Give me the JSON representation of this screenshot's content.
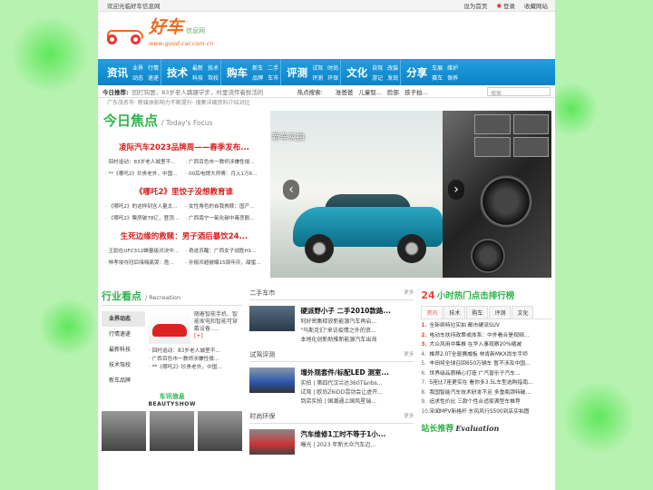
{
  "topbar": {
    "welcome": "欢迎光临好车信息网",
    "home": "设为首页",
    "login": "登录",
    "fav": "收藏网站"
  },
  "logo": {
    "brand": "好车",
    "tag": "信息网",
    "url": "www.good-car.com.cn"
  },
  "nav": [
    {
      "big": "资讯",
      "subs": [
        "业界",
        "行情",
        "动态",
        "速递"
      ]
    },
    {
      "big": "技术",
      "subs": [
        "最新",
        "技术",
        "科技",
        "驾校"
      ]
    },
    {
      "big": "购车",
      "subs": [
        "新车",
        "二手",
        "品牌",
        "车市"
      ]
    },
    {
      "big": "评测",
      "subs": [
        "试驾",
        "时尚",
        "评测",
        "环保"
      ]
    },
    {
      "big": "文化",
      "subs": [
        "自驾",
        "改装",
        "游记",
        "发现"
      ]
    },
    {
      "big": "分享",
      "subs": [
        "车展",
        "维护",
        "赛车",
        "保养"
      ]
    }
  ],
  "subnav": {
    "label": "今日推荐:",
    "ticker": "回打钩罢，83岁老人蹒跚学步，村里流传着鲜活的",
    "hot_label": "热点搜索:",
    "hot": [
      "准爸爸",
      "儿童智...",
      "脸部",
      "孩子拍..."
    ],
    "search_placeholder": "搜索"
  },
  "ticker2": "广东茂名市·  新媒体影响力不断提升·  搜集详细资料介绍对比",
  "focus": {
    "title": "今日焦点",
    "en": "/ Today's Focus",
    "blocks": [
      {
        "headline": "凌际汽车2023品牌周——春季发布...",
        "items": [
          "回村追动：83岁老人城里不...",
          "广西百色市一教师涉嫌性侵...",
          "**《哪吒2》珍贵老外，中国...",
          "00后电焊大师傅：月入1万6..."
        ]
      },
      {
        "headline": "《哪吒2》里饺子没想教育谁",
        "items": [
          "《哪吒2》的这样刻含人量太...",
          "女性角色的自我救赎：国产...",
          "《哪吒2》票房破78亿，登顶...",
          "广西南宁一氧化碳中毒悲剧..."
        ]
      },
      {
        "headline": "生死边缘的救赎：男子酒后暴饮24...",
        "items": [
          "王励在UFC312蝉量级对决中...",
          "奇迹苏醒：广西女子战胜H1...",
          "林孝埈夺冠后嗨嗨痛哭：胜...",
          "孙俪邓超被曝15周年庆，甜蜜..."
        ]
      }
    ]
  },
  "slider": {
    "caption": "新车实拍"
  },
  "leisure": {
    "title": "行业看点",
    "en": "/ Recreation",
    "tabs": [
      "业界动态",
      "行情速递",
      "最新科技",
      "技术驾校",
      "新车品牌"
    ],
    "desc": "随着智能手机、智能家电和智能可穿戴设备.....",
    "more": "[+]",
    "items": [
      "回村追动：83岁老人城里不...",
      "广西百色市一教师涉嫌性侵...",
      "**《哪吒2》珍贵老外，中国..."
    ]
  },
  "carinfo": {
    "cn": "车讯信息",
    "en": "BEAUTYSHOW"
  },
  "mid": [
    {
      "title": "二手车市",
      "more": "更多",
      "head": "硬派野小子 二手2010款路...",
      "items": [
        "利好密集释放新能源汽车再启...",
        "\"马斯克们\"来访疫情之外的资...",
        "本地化创新助推新能源汽车出海"
      ]
    },
    {
      "title": "试驾评测",
      "more": "更多",
      "head": "增外观套件/标配LED 测室...",
      "items": [
        "实拍 | 第四代汉兰达360T&nbs...",
        "试驾 | 欧尚Z6iDD混动会让虚开...",
        "到店实拍 | 国潮通上国风星瑞..."
      ]
    },
    {
      "title": "时尚环保",
      "more": "更多",
      "head": "汽车维修1工时不等于1小...",
      "items": [
        "曝光 | 2023 年新大众汽车迈..."
      ]
    }
  ],
  "rank": {
    "num": "24",
    "title": "小时热门点击排行榜",
    "tabs": [
      "资讯",
      "技术",
      "购车",
      "评测",
      "文化"
    ],
    "items": [
      "全新缤特拉实拍 都市硬派SUV",
      "电动车扶持政策或体系：中外看合是视频...",
      "大众风用中集推 在华入事观察20%缩减",
      "推荐2.0T全驱赛威板 林肯新MKX尚车手师",
      "丰田将全球召回650万辆车 暂不涉及中国...",
      "世界级品质精心打造 广汽普乐子汽车...",
      "5座比7座更实在 看你多3.5L车型选购指南...",
      "我国智能汽车技术研发不足 多重瓶颈特破...",
      "追求性价比 三款个性合适家满型车推荐",
      "宋闻MPV新格杆 东风风行S500到店实拍图"
    ],
    "station_cn": "站长推荐",
    "station_en": "Evaluation"
  }
}
